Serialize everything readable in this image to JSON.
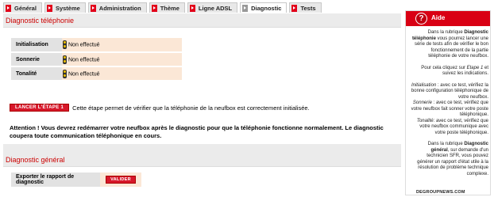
{
  "tabs": [
    {
      "label": "Général",
      "active": false
    },
    {
      "label": "Système",
      "active": false
    },
    {
      "label": "Administration",
      "active": false
    },
    {
      "label": "Thème",
      "active": false
    },
    {
      "label": "Ligne ADSL",
      "active": false
    },
    {
      "label": "Diagnostic",
      "active": true
    },
    {
      "label": "Tests",
      "active": false
    }
  ],
  "phone_diag": {
    "title": "Diagnostic téléphonie",
    "rows": [
      {
        "label": "Initialisation",
        "status": "Non effectué"
      },
      {
        "label": "Sonnerie",
        "status": "Non effectué"
      },
      {
        "label": "Tonalité",
        "status": "Non effectué"
      }
    ],
    "launch_button": "LANCER L'ÉTAPE 1",
    "launch_text": "Cette étape permet de vérifier que la téléphonie de la neufbox est correctement initialisée.",
    "warning": "Attention ! Vous devrez redémarrer votre neufbox après le diagnostic pour que la téléphonie fonctionne normalement. Le diagnostic coupera toute communication téléphonique en cours."
  },
  "general_diag": {
    "title": "Diagnostic général",
    "export_label": "Exporter le rapport de diagnostic",
    "validate_button": "VALIDER"
  },
  "help": {
    "title": "Aide",
    "icon": "question-icon",
    "p1_pre": "Dans la rubrique ",
    "p1_bold": "Diagnostic téléphonie",
    "p1_post": " vous pourrez lancer une série de tests afin de vérifier le bon fonctionnement de la partie téléphonie de votre neufbox.",
    "p2_pre": "Pour cela cliquez sur ",
    "p2_em": "Etape 1",
    "p2_post": " et suivez les indications.",
    "p3a_em": "Initialisation",
    "p3a": " : avec ce test, vérifiez la bonne configuration téléphonique de votre neufbox.",
    "p3b_em": "Sonnerie",
    "p3b": " : avec ce test, vérifiez que votre neufbox fait sonner votre poste téléphonique.",
    "p3c_em": "Tonalité",
    "p3c": ": avec ce test, vérifiez que votre neufbox communique avec votre poste téléphonique.",
    "p4_pre": "Dans la rubrique ",
    "p4_bold": "Diagnostic général",
    "p4_post": ", sur demande d'un technicien SFR, vous pouvez générer un rapport d'état utile à la résolution de problème technique complexe.",
    "footer": "DEGROUPNEWS.COM"
  },
  "colors": {
    "accent": "#d90014",
    "status_bg": "#fbe7d6",
    "label_bg": "#e2e2e2",
    "panel_bg": "#ebebeb"
  }
}
